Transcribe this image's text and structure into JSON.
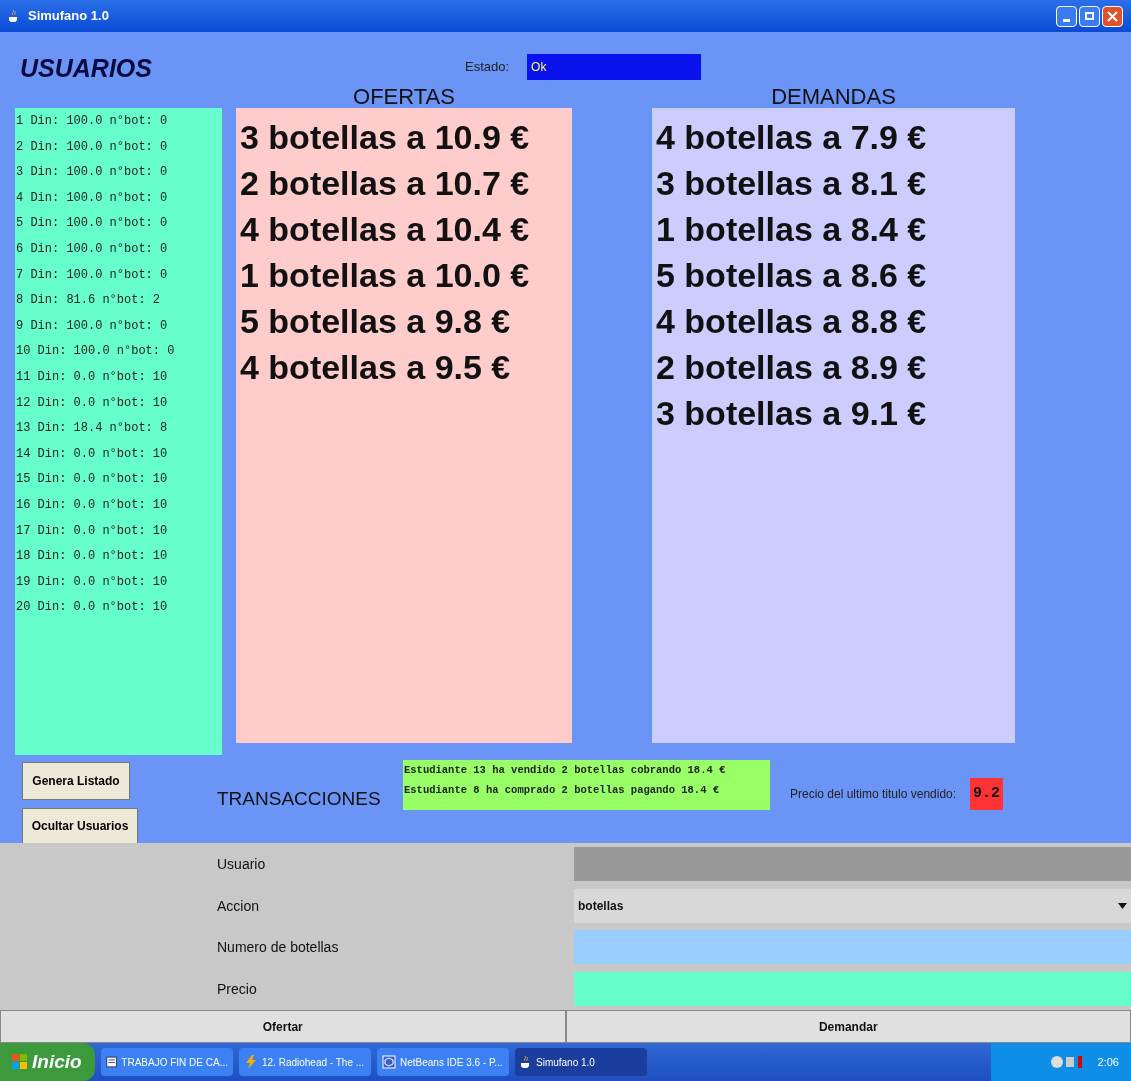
{
  "window": {
    "title": "Simufano 1.0"
  },
  "usuarios": {
    "title": "USUARIOS",
    "items": [
      "1 Din: 100.0 n°bot: 0",
      "2 Din: 100.0 n°bot: 0",
      "3 Din: 100.0 n°bot: 0",
      "4 Din: 100.0 n°bot: 0",
      "5 Din: 100.0 n°bot: 0",
      "6 Din: 100.0 n°bot: 0",
      "7 Din: 100.0 n°bot: 0",
      "8 Din: 81.6 n°bot: 2",
      "9 Din: 100.0 n°bot: 0",
      "10 Din: 100.0 n°bot: 0",
      "11 Din: 0.0 n°bot: 10",
      "12 Din: 0.0 n°bot: 10",
      "13 Din: 18.4 n°bot: 8",
      "14 Din: 0.0 n°bot: 10",
      "15 Din: 0.0 n°bot: 10",
      "16 Din: 0.0 n°bot: 10",
      "17 Din: 0.0 n°bot: 10",
      "18 Din: 0.0 n°bot: 10",
      "19 Din: 0.0 n°bot: 10",
      "20 Din: 0.0 n°bot: 10"
    ]
  },
  "estado": {
    "label": "Estado:",
    "value": "Ok"
  },
  "ofertas": {
    "title": "OFERTAS",
    "items": [
      "3 botellas a 10.9 €",
      "2 botellas a 10.7 €",
      "4 botellas a 10.4 €",
      "1 botellas a 10.0 €",
      "5 botellas a 9.8 €",
      "4 botellas a 9.5 €"
    ]
  },
  "demandas": {
    "title": "DEMANDAS",
    "items": [
      "4 botellas a 7.9 €",
      "3 botellas a 8.1 €",
      "1 botellas a 8.4 €",
      "5 botellas a 8.6 €",
      "4 botellas a 8.8 €",
      "2 botellas a 8.9 €",
      "3 botellas a 9.1 €"
    ]
  },
  "side_buttons": [
    "Genera Listado",
    "Ocultar Usuarios"
  ],
  "transacciones": {
    "title": "TRANSACCIONES",
    "lines": [
      "Estudiante 13 ha vendido 2 botellas cobrando 18.4 €",
      "Estudiante 8 ha comprado 2 botellas pagando 18.4 €"
    ]
  },
  "ultimo_precio": {
    "label": "Precio del ultimo titulo vendido:",
    "value": "9.2"
  },
  "form": [
    {
      "label": "Usuario",
      "kind": "text",
      "color": "#999999"
    },
    {
      "label": "Accion",
      "kind": "select",
      "value": "botellas"
    },
    {
      "label": "Numero de botellas",
      "kind": "text",
      "color": "#99ccff"
    },
    {
      "label": "Precio",
      "kind": "text",
      "color": "#66ffcc"
    }
  ],
  "actions": [
    "Ofertar",
    "Demandar"
  ],
  "taskbar": {
    "start": "Inicio",
    "tasks": [
      {
        "label": "TRABAJO FIN DE CA...",
        "kind": "doc",
        "selected": false
      },
      {
        "label": "12. Radiohead - The ...",
        "kind": "music",
        "selected": false
      },
      {
        "label": "NetBeans IDE 3.6 - P...",
        "kind": "ide",
        "selected": false
      },
      {
        "label": "Simufano 1.0",
        "kind": "java",
        "selected": true
      }
    ],
    "clock": "2:06"
  }
}
